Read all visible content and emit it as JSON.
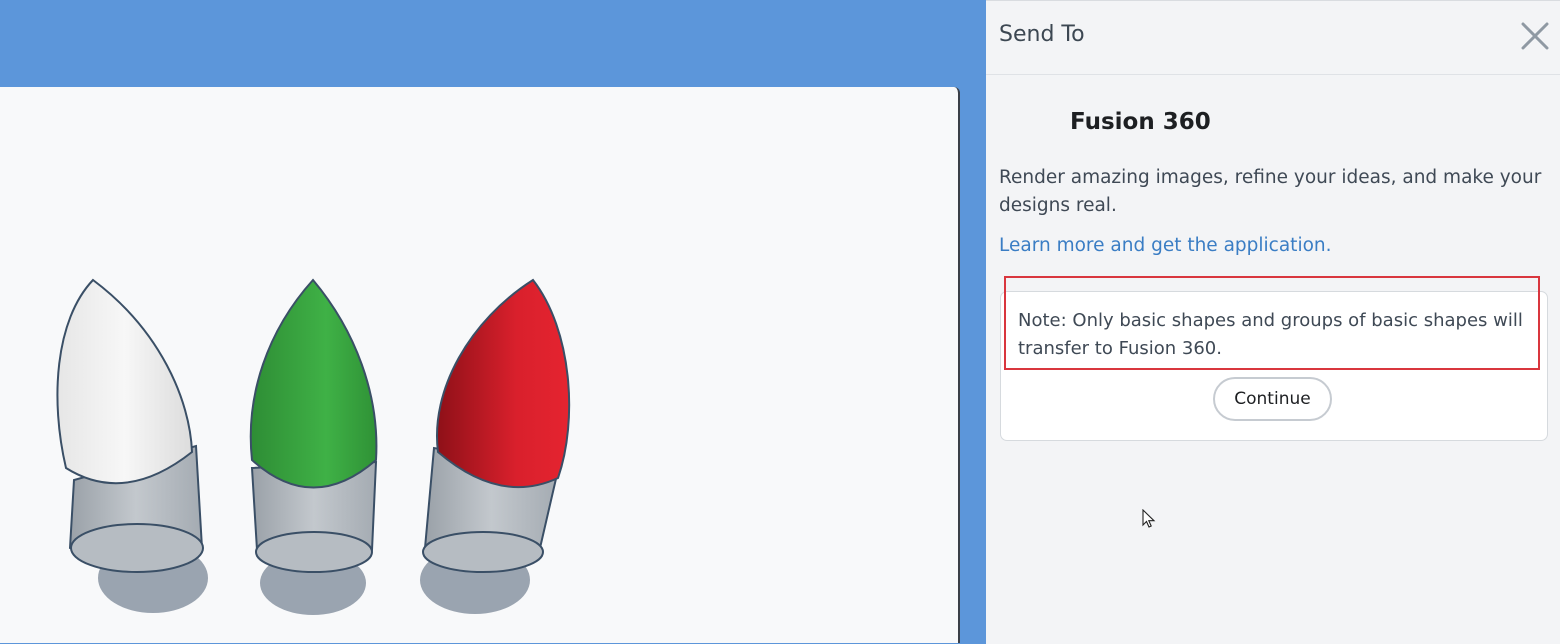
{
  "panel": {
    "title": "Send To",
    "close_icon": "close-icon",
    "app_name": "Fusion 360",
    "description": "Render amazing images, refine your ideas, and make your designs real.",
    "learn_link": "Learn more and get the application.",
    "note": "Note: Only basic shapes and groups of basic shapes will transfer to Fusion 360.",
    "continue_label": "Continue"
  },
  "scene": {
    "objects": [
      {
        "name": "white-bulb",
        "color": "#f0f0f0"
      },
      {
        "name": "green-bulb",
        "color": "#3aa43f"
      },
      {
        "name": "red-bulb",
        "color": "#d9202c"
      }
    ]
  },
  "colors": {
    "accent_blue": "#5c96da",
    "highlight_red": "#d9363e",
    "link_blue": "#3a7dc4"
  }
}
